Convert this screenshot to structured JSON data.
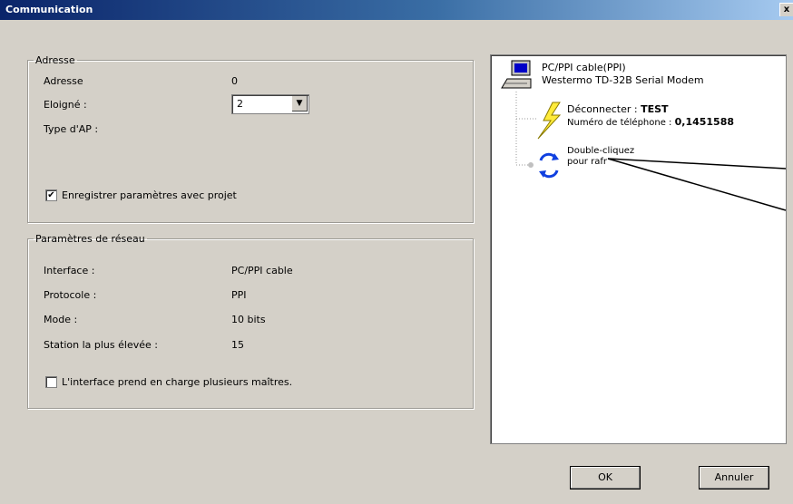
{
  "window": {
    "title": "Communication",
    "close": "x"
  },
  "adresse": {
    "legend": "Adresse",
    "adresse_label": "Adresse",
    "adresse_value": "0",
    "eloigne_label": "Eloigné :",
    "eloigne_value": "2",
    "type_label": "Type d'AP :",
    "save_checkbox": {
      "label": "Enregistrer paramètres avec projet",
      "checked": true
    }
  },
  "reseau": {
    "legend": "Paramètres de réseau",
    "rows": [
      {
        "label": "Interface :",
        "value": "PC/PPI cable"
      },
      {
        "label": "Protocole :",
        "value": "PPI"
      },
      {
        "label": "Mode :",
        "value": "10 bits"
      },
      {
        "label": "Station la plus élevée :",
        "value": "15"
      }
    ],
    "multi_master_checkbox": {
      "label": "L'interface prend en charge plusieurs maîtres.",
      "checked": false
    }
  },
  "tree": {
    "root_line1": "PC/PPI cable(PPI)",
    "root_line2": "Westermo TD-32B Serial Modem",
    "disconnect_prefix": "Déconnecter : ",
    "disconnect_name": "TEST",
    "phone_prefix": "Numéro de téléphone : ",
    "phone_number": "0,1451588",
    "refresh_line1": "Double-cliquez",
    "refresh_line2": "pour rafr"
  },
  "buttons": {
    "ok": "OK",
    "cancel": "Annuler"
  },
  "icons": {
    "computer": "computer-icon",
    "lightning": "lightning-icon",
    "refresh": "refresh-icon"
  }
}
